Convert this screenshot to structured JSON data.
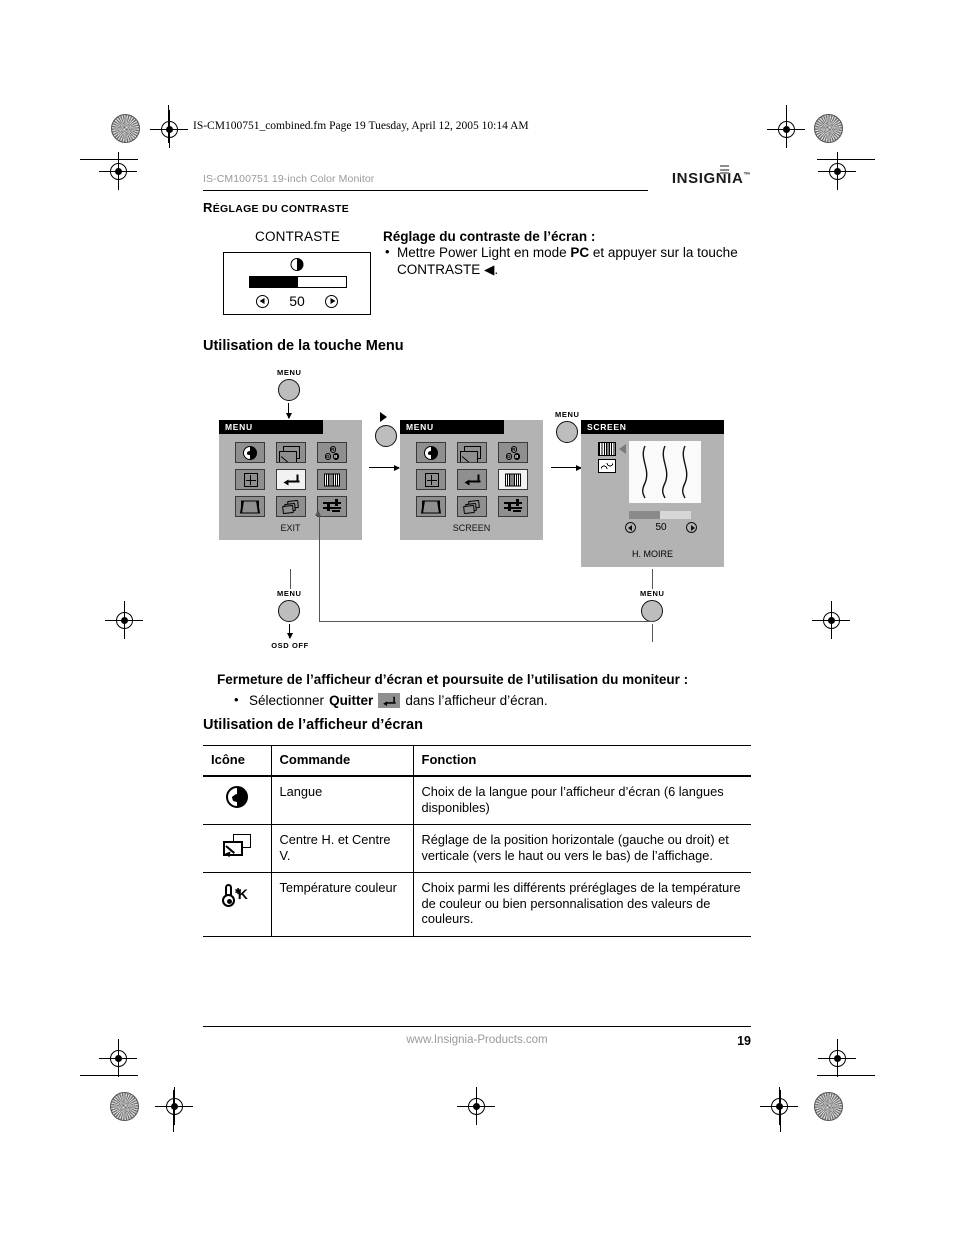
{
  "print_header": "IS-CM100751_combined.fm  Page 19  Tuesday, April 12, 2005  10:14 AM",
  "header": {
    "doc_title": "IS-CM100751 19-inch Color Monitor",
    "brand": "INSIGNIA",
    "brand_tm": "™"
  },
  "section": {
    "kicker_first": "R",
    "kicker_rest": "ÉGLAGE DU CONTRASTE"
  },
  "contrast": {
    "label": "CONTRASTE",
    "value": "50",
    "fill_percent": 50,
    "left_arrow": "◀",
    "right_arrow": "▶",
    "heading": "Réglage du contraste de l’écran :",
    "bullet_pre": "Mettre Power Light en mode ",
    "bullet_bold": "PC",
    "bullet_post": " et appuyer sur la touche CONTRASTE ◀."
  },
  "menu_usage": {
    "heading": "Utilisation de la touche Menu",
    "button_label": "MENU",
    "osd_off_label": "OSD OFF",
    "panel1": {
      "title": "MENU",
      "footer": "EXIT",
      "icons": [
        {
          "name": "language-globe-icon",
          "selected": false
        },
        {
          "name": "center-hv-icon",
          "selected": false
        },
        {
          "name": "color-temperature-rgb-icon",
          "selected": false
        },
        {
          "name": "size-hv-icon",
          "selected": false
        },
        {
          "name": "exit-enter-icon",
          "selected": true
        },
        {
          "name": "moire-grid-icon",
          "selected": false
        },
        {
          "name": "trapezoid-icon",
          "selected": false
        },
        {
          "name": "pincushion-pages-icon",
          "selected": false
        },
        {
          "name": "misc-slider-icon",
          "selected": false
        }
      ]
    },
    "panel2": {
      "title": "MENU",
      "footer": "SCREEN",
      "icons": [
        {
          "name": "language-globe-icon",
          "selected": false
        },
        {
          "name": "center-hv-icon",
          "selected": false
        },
        {
          "name": "color-temperature-rgb-icon",
          "selected": false
        },
        {
          "name": "size-hv-icon",
          "selected": false
        },
        {
          "name": "exit-enter-icon",
          "selected": false
        },
        {
          "name": "moire-grid-icon",
          "selected": true
        },
        {
          "name": "trapezoid-icon",
          "selected": false
        },
        {
          "name": "pincushion-pages-icon",
          "selected": false
        },
        {
          "name": "misc-slider-icon",
          "selected": false
        }
      ]
    },
    "panel3": {
      "title": "SCREEN",
      "footer": "H. MOIRE",
      "value": "50",
      "fill_percent": 50,
      "sub_icons": [
        "h-moire-icon",
        "v-moire-icon"
      ]
    }
  },
  "closing": {
    "heading": "Fermeture de l’afficheur d’écran et poursuite de l’utilisation du moniteur :",
    "bullet_pre": "Sélectionner ",
    "bullet_bold": "Quitter",
    "bullet_post": "dans l’afficheur d’écran."
  },
  "osd_usage": {
    "heading": "Utilisation de l’afficheur d’écran",
    "columns": [
      "Icône",
      "Commande",
      "Fonction"
    ],
    "rows": [
      {
        "icon": "language-globe-icon",
        "command": "Langue",
        "function": "Choix de la langue pour l’afficheur d’écran (6 langues disponibles)"
      },
      {
        "icon": "center-hv-icon",
        "command": "Centre H. et Centre V.",
        "function": "Réglage de la position horizontale (gauche ou droit) et verticale (vers le haut ou vers le bas) de l’affichage."
      },
      {
        "icon": "color-temperature-icon",
        "command": "Température couleur",
        "function": "Choix parmi les différents préréglages de la température de couleur ou bien personnalisation des valeurs de couleurs."
      }
    ]
  },
  "footer": {
    "website": "www.Insignia-Products.com",
    "page_number": "19"
  }
}
